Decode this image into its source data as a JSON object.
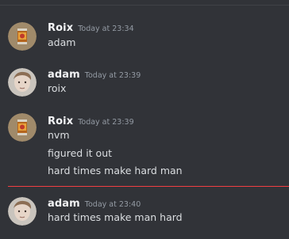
{
  "messages": [
    {
      "author": "Roix",
      "time": "Today at 23:34",
      "lines": [
        "adam"
      ],
      "avatar_icon": "soda-can-avatar-icon"
    },
    {
      "author": "adam",
      "time": "Today at 23:39",
      "lines": [
        "roix"
      ],
      "avatar_icon": "profile-photo-avatar-icon"
    },
    {
      "author": "Roix",
      "time": "Today at 23:39",
      "lines": [
        "nvm",
        "figured it out",
        "hard times make hard man"
      ],
      "avatar_icon": "soda-can-avatar-icon"
    },
    {
      "author": "adam",
      "time": "Today at 23:40",
      "lines": [
        "hard times make man hard"
      ],
      "avatar_icon": "profile-photo-avatar-icon"
    }
  ],
  "colors": {
    "background": "#313338",
    "new_messages_divider": "#f23f43",
    "username": "#f2f3f5",
    "timestamp": "#949ba4",
    "message_text": "#dbdee1"
  }
}
